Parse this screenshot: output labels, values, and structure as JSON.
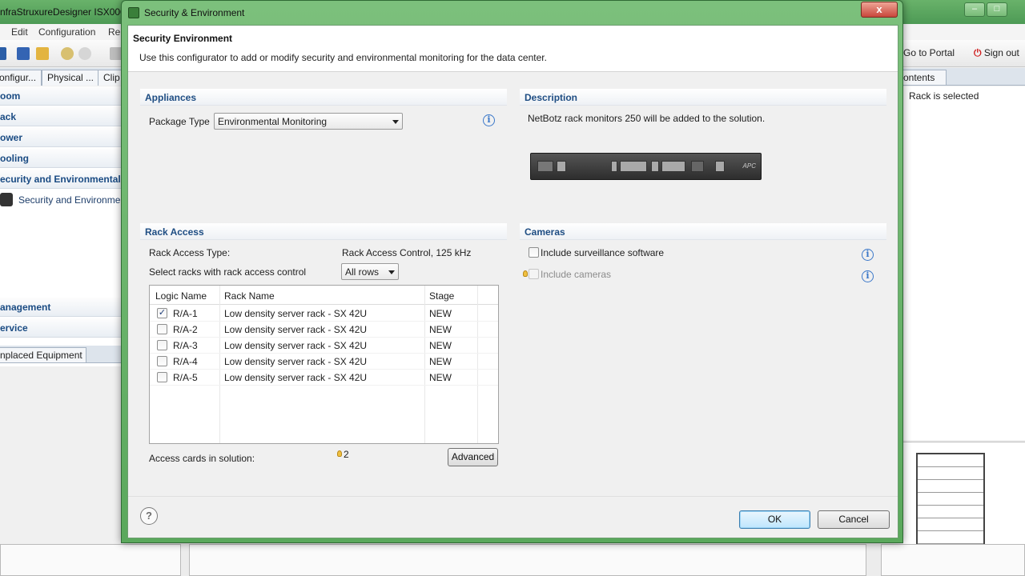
{
  "background": {
    "title": "nfraStruxureDesigner ISX000",
    "menu": [
      "Edit",
      "Configuration",
      "Re"
    ],
    "tabs": [
      "onfigur...",
      "Physical ...",
      "Clip"
    ],
    "categories": [
      "oom",
      "ack",
      "ower",
      "ooling",
      "ecurity and Environmental"
    ],
    "selected_item": "Security and Environmen",
    "categories_lower": [
      "anagement",
      "ervice"
    ],
    "unplaced_tab": "nplaced Equipment",
    "go_to_portal": "Go to Portal",
    "sign_out": "Sign out",
    "right_tab": "ontents",
    "right_status": "Rack is selected"
  },
  "dialog": {
    "title": "Security & Environment",
    "close_glyph": "x",
    "header": {
      "heading": "Security  Environment",
      "subtitle": "Use this configurator to add or modify security and environmental monitoring for the data center."
    },
    "appliances": {
      "section": "Appliances",
      "package_type_label": "Package Type",
      "package_type_value": "Environmental Monitoring"
    },
    "description": {
      "section": "Description",
      "text": "NetBotz rack monitors 250 will be added to the solution.",
      "device_brand": "APC"
    },
    "rack_access": {
      "section": "Rack Access",
      "type_label": "Rack Access Type:",
      "type_value": "Rack Access Control, 125 kHz",
      "select_label": "Select racks with rack access control",
      "select_value": "All rows",
      "columns": [
        "Logic Name",
        "Rack Name",
        "Stage"
      ],
      "rows": [
        {
          "logic": "R/A-1",
          "rack": "Low density server rack - SX 42U",
          "stage": "NEW",
          "checked": true
        },
        {
          "logic": "R/A-2",
          "rack": "Low density server rack - SX 42U",
          "stage": "NEW",
          "checked": false
        },
        {
          "logic": "R/A-3",
          "rack": "Low density server rack - SX 42U",
          "stage": "NEW",
          "checked": false
        },
        {
          "logic": "R/A-4",
          "rack": "Low density server rack - SX 42U",
          "stage": "NEW",
          "checked": false
        },
        {
          "logic": "R/A-5",
          "rack": "Low density server rack - SX 42U",
          "stage": "NEW",
          "checked": false
        }
      ],
      "access_cards_label": "Access cards in solution:",
      "access_cards_value": "2",
      "advanced_label": "Advanced"
    },
    "cameras": {
      "section": "Cameras",
      "surveillance_label": "Include surveillance software",
      "cameras_label": "Include cameras"
    },
    "footer": {
      "help_glyph": "?",
      "ok_label": "OK",
      "cancel_label": "Cancel"
    }
  },
  "colors": {
    "section_heading": "#1e4d83",
    "window_frame": "#5aa85c",
    "info_icon": "#3b78c9"
  }
}
